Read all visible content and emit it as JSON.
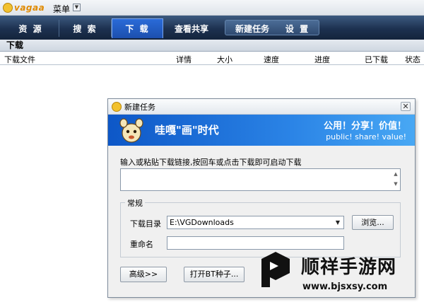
{
  "app": {
    "logo_text": "vagaa",
    "menu_label": "菜单"
  },
  "nav": {
    "tabs": [
      {
        "label": "资 源"
      },
      {
        "label": "搜 索"
      },
      {
        "label": "下 载"
      },
      {
        "label": "查看共享"
      }
    ],
    "extra": [
      {
        "label": "新建任务"
      },
      {
        "label": "设 置"
      }
    ],
    "active_tab": "下 载"
  },
  "section": {
    "title": "下载",
    "columns": [
      "下载文件",
      "详情",
      "大小",
      "速度",
      "进度",
      "已下载",
      "状态"
    ]
  },
  "dialog": {
    "title": "新建任务",
    "banner": {
      "slogan": "哇嘎\"画\"时代",
      "right_cn": "公用！分享！价值！",
      "right_en": "public! share! value!"
    },
    "hint": "输入或粘贴下载链接,按回车或点击下载即可启动下载",
    "link_value": "",
    "group": {
      "legend": "常规",
      "dir_label": "下载目录",
      "dir_value": "E:\\VGDownloads",
      "browse_label": "浏览...",
      "rename_label": "重命名",
      "rename_value": ""
    },
    "advanced_label": "高级>>",
    "open_bt_label": "打开BT种子..."
  },
  "watermark": {
    "name": "顺祥手游网",
    "url": "www.bjsxsy.com"
  },
  "colors": {
    "nav_bg": "#1d3150",
    "active_tab": "#1c4fae",
    "banner": "#2b84e6"
  }
}
